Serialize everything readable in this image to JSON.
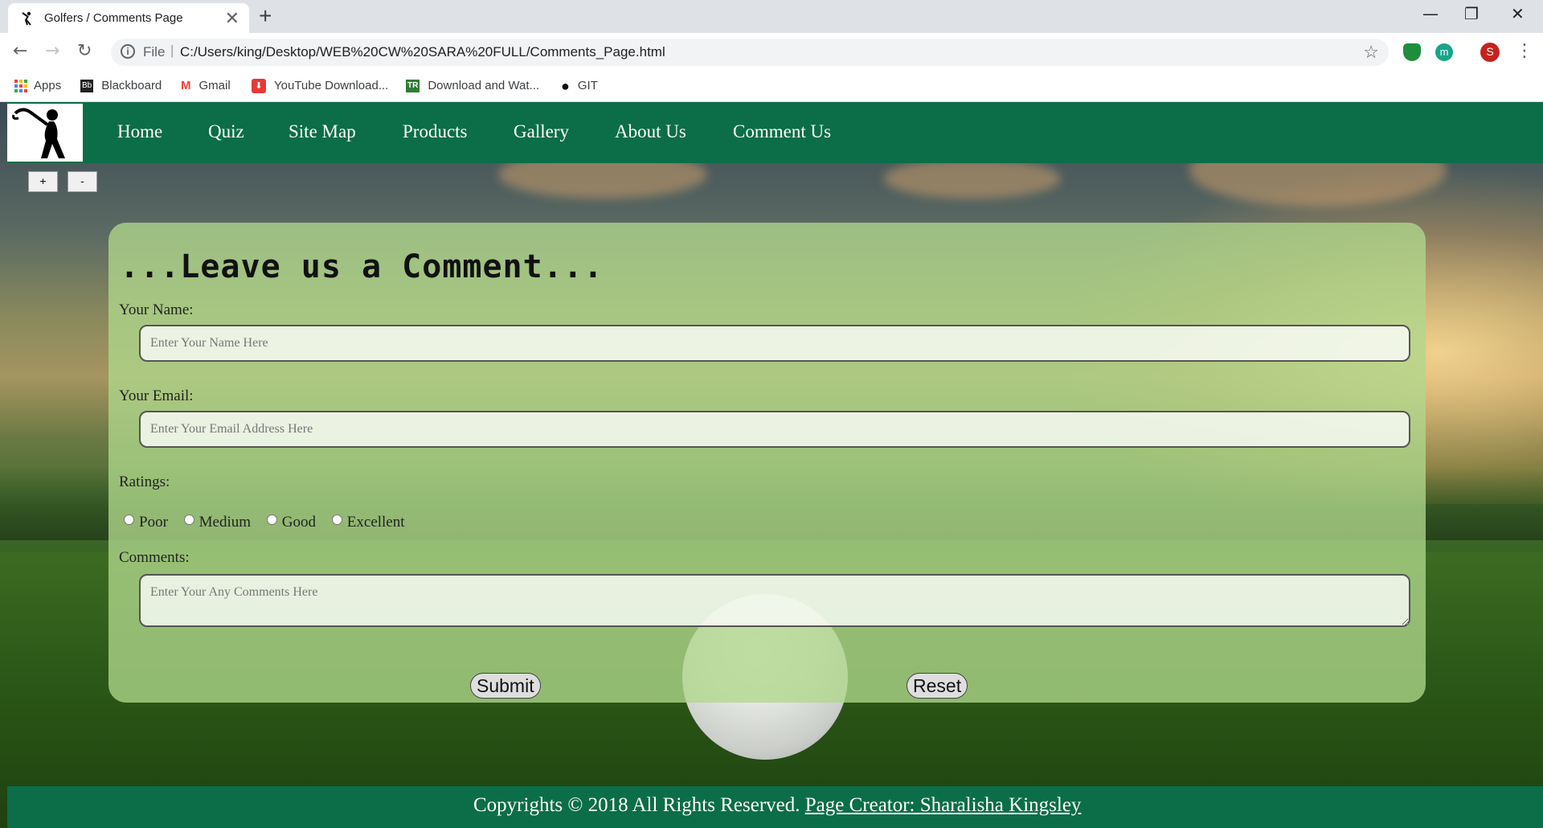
{
  "browser": {
    "tab_title": "Golfers / Comments Page",
    "tab_close": "✕",
    "new_tab": "+",
    "window_controls": {
      "minimize": "—",
      "restore": "❐",
      "close": "✕"
    },
    "nav": {
      "back": "←",
      "forward": "→",
      "reload": "↻"
    },
    "address": {
      "info": "i",
      "scheme": "File",
      "separator": "|",
      "url": "C:/Users/king/Desktop/WEB%20CW%20SARA%20FULL/Comments_Page.html",
      "star": "☆"
    },
    "avatar_letter": "S",
    "ext_letter": "m",
    "menu": "⋮",
    "bookmarks": [
      {
        "label": "Apps",
        "icon": "apps-grid-icon"
      },
      {
        "label": "Blackboard",
        "icon": "blackboard-icon",
        "glyph": "Bb"
      },
      {
        "label": "Gmail",
        "icon": "gmail-icon",
        "glyph": "M"
      },
      {
        "label": "YouTube Download...",
        "icon": "youtube-download-icon",
        "glyph": "⬇"
      },
      {
        "label": "Download and Wat...",
        "icon": "download-watch-icon",
        "glyph": "TR"
      },
      {
        "label": "GIT",
        "icon": "github-icon",
        "glyph": "●"
      }
    ]
  },
  "site": {
    "nav": [
      "Home",
      "Quiz",
      "Site Map",
      "Products",
      "Gallery",
      "About Us",
      "Comment Us"
    ],
    "zoom_in": "+",
    "zoom_out": "-",
    "form": {
      "heading": "...Leave us a Comment...",
      "name_label": "Your Name:",
      "name_placeholder": "Enter Your Name Here",
      "email_label": "Your Email:",
      "email_placeholder": "Enter Your Email Address Here",
      "ratings_label": "Ratings:",
      "ratings": [
        "Poor",
        "Medium",
        "Good",
        "Excellent"
      ],
      "comments_label": "Comments:",
      "comments_placeholder": "Enter Your Any Comments Here",
      "submit": "Submit",
      "reset": "Reset"
    },
    "footer": {
      "copyright": "Copyrights © 2018 All Rights Reserved.",
      "creator_link": "Page Creator: Sharalisha Kingsley"
    }
  },
  "colors": {
    "nav_green": "#0b6e48",
    "panel_green": "#afd78c"
  }
}
